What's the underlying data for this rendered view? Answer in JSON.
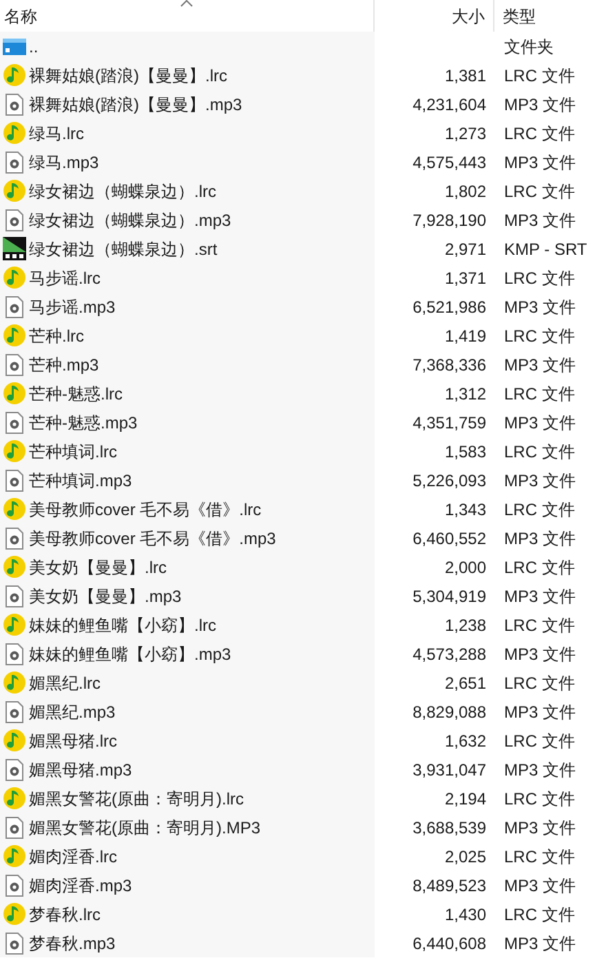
{
  "columns": [
    {
      "label": "名称",
      "sorted": true
    },
    {
      "label": "大小",
      "sorted": false
    },
    {
      "label": "类型",
      "sorted": false
    }
  ],
  "files": [
    {
      "kind": "folder",
      "name": "..",
      "type": "文件夹"
    },
    {
      "kind": "lrc",
      "name": "裸舞姑娘(踏浪)【曼曼】.lrc",
      "size": "1,381",
      "type": "LRC 文件"
    },
    {
      "kind": "mp3",
      "name": "裸舞姑娘(踏浪)【曼曼】.mp3",
      "size": "4,231,604",
      "type": "MP3 文件"
    },
    {
      "kind": "lrc",
      "name": "绿马.lrc",
      "size": "1,273",
      "type": "LRC 文件"
    },
    {
      "kind": "mp3",
      "name": "绿马.mp3",
      "size": "4,575,443",
      "type": "MP3 文件"
    },
    {
      "kind": "lrc",
      "name": "绿女裙边（蝴蝶泉边）.lrc",
      "size": "1,802",
      "type": "LRC 文件"
    },
    {
      "kind": "mp3",
      "name": "绿女裙边（蝴蝶泉边）.mp3",
      "size": "7,928,190",
      "type": "MP3 文件"
    },
    {
      "kind": "srt",
      "name": "绿女裙边（蝴蝶泉边）.srt",
      "size": "2,971",
      "type": "KMP - SRT"
    },
    {
      "kind": "lrc",
      "name": "马步谣.lrc",
      "size": "1,371",
      "type": "LRC 文件"
    },
    {
      "kind": "mp3",
      "name": "马步谣.mp3",
      "size": "6,521,986",
      "type": "MP3 文件"
    },
    {
      "kind": "lrc",
      "name": "芒种.lrc",
      "size": "1,419",
      "type": "LRC 文件"
    },
    {
      "kind": "mp3",
      "name": "芒种.mp3",
      "size": "7,368,336",
      "type": "MP3 文件"
    },
    {
      "kind": "lrc",
      "name": "芒种-魅惑.lrc",
      "size": "1,312",
      "type": "LRC 文件"
    },
    {
      "kind": "mp3",
      "name": "芒种-魅惑.mp3",
      "size": "4,351,759",
      "type": "MP3 文件"
    },
    {
      "kind": "lrc",
      "name": "芒种填词.lrc",
      "size": "1,583",
      "type": "LRC 文件"
    },
    {
      "kind": "mp3",
      "name": "芒种填词.mp3",
      "size": "5,226,093",
      "type": "MP3 文件"
    },
    {
      "kind": "lrc",
      "name": "美母教师cover 毛不易《借》.lrc",
      "size": "1,343",
      "type": "LRC 文件"
    },
    {
      "kind": "mp3",
      "name": "美母教师cover 毛不易《借》.mp3",
      "size": "6,460,552",
      "type": "MP3 文件"
    },
    {
      "kind": "lrc",
      "name": "美女奶【曼曼】.lrc",
      "size": "2,000",
      "type": "LRC 文件"
    },
    {
      "kind": "mp3",
      "name": "美女奶【曼曼】.mp3",
      "size": "5,304,919",
      "type": "MP3 文件"
    },
    {
      "kind": "lrc",
      "name": "妹妹的鲤鱼嘴【小窈】.lrc",
      "size": "1,238",
      "type": "LRC 文件"
    },
    {
      "kind": "mp3",
      "name": "妹妹的鲤鱼嘴【小窈】.mp3",
      "size": "4,573,288",
      "type": "MP3 文件"
    },
    {
      "kind": "lrc",
      "name": "媚黑纪.lrc",
      "size": "2,651",
      "type": "LRC 文件"
    },
    {
      "kind": "mp3",
      "name": "媚黑纪.mp3",
      "size": "8,829,088",
      "type": "MP3 文件"
    },
    {
      "kind": "lrc",
      "name": "媚黑母猪.lrc",
      "size": "1,632",
      "type": "LRC 文件"
    },
    {
      "kind": "mp3",
      "name": "媚黑母猪.mp3",
      "size": "3,931,047",
      "type": "MP3 文件"
    },
    {
      "kind": "lrc",
      "name": "媚黑女警花(原曲：寄明月).lrc",
      "size": "2,194",
      "type": "LRC 文件"
    },
    {
      "kind": "mp3",
      "name": "媚黑女警花(原曲：寄明月).MP3",
      "size": "3,688,539",
      "type": "MP3 文件"
    },
    {
      "kind": "lrc",
      "name": "媚肉淫香.lrc",
      "size": "2,025",
      "type": "LRC 文件"
    },
    {
      "kind": "mp3",
      "name": "媚肉淫香.mp3",
      "size": "8,489,523",
      "type": "MP3 文件"
    },
    {
      "kind": "lrc",
      "name": "梦春秋.lrc",
      "size": "1,430",
      "type": "LRC 文件"
    },
    {
      "kind": "mp3",
      "name": "梦春秋.mp3",
      "size": "6,440,608",
      "type": "MP3 文件"
    }
  ]
}
